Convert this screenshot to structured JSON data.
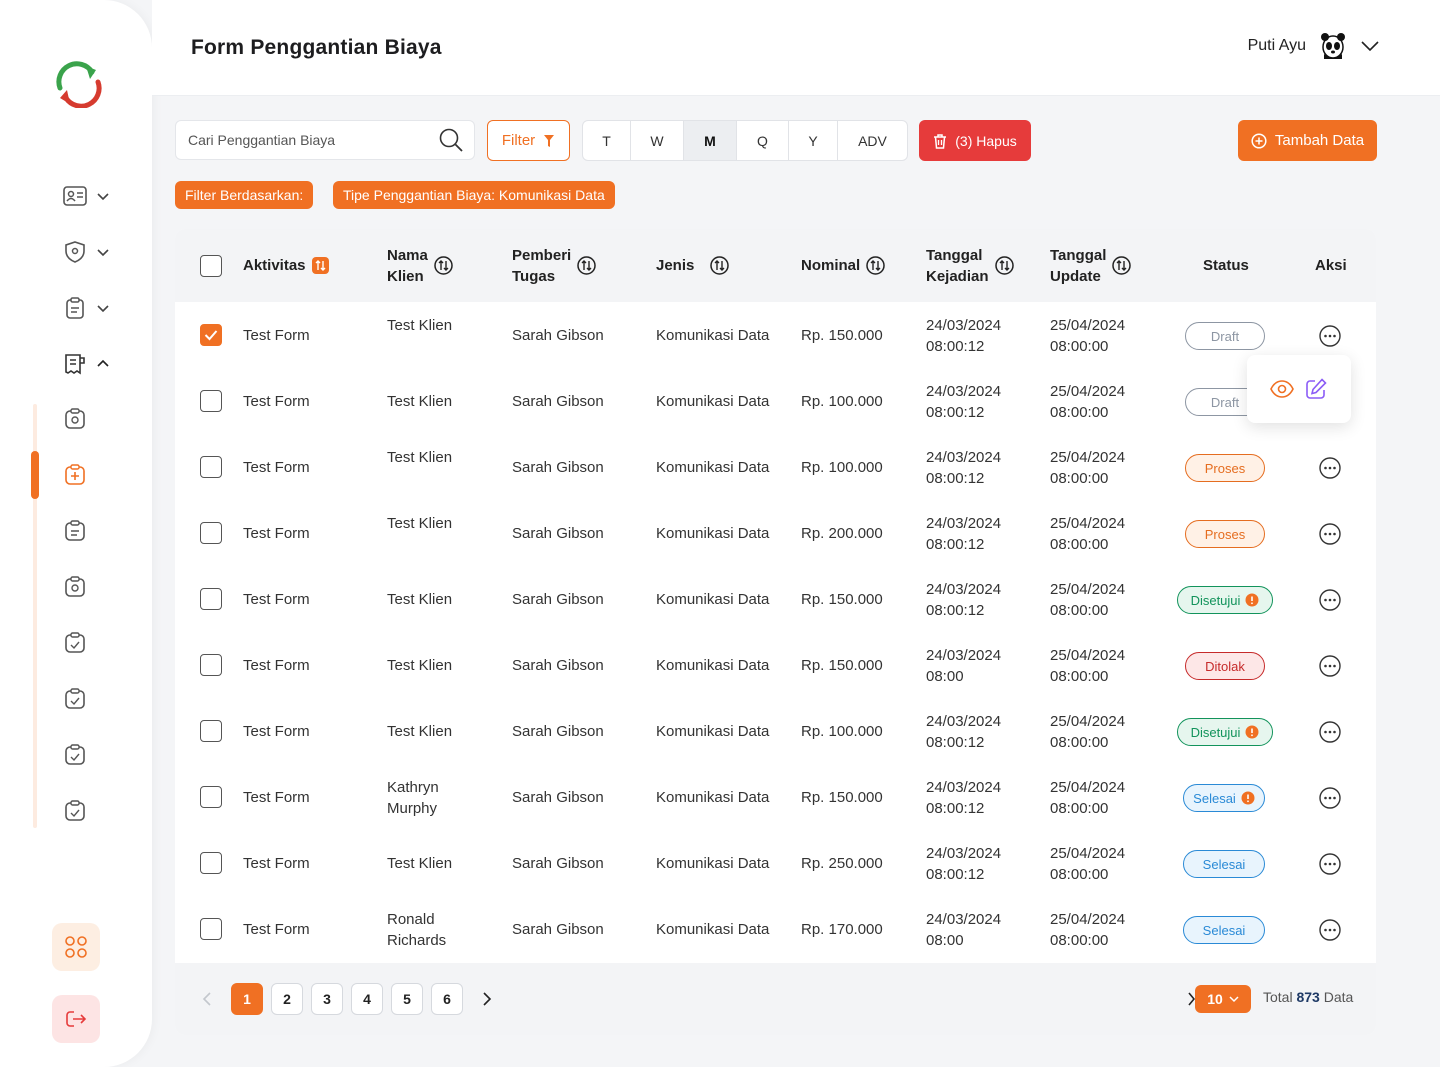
{
  "page": {
    "title": "Form Penggantian Biaya"
  },
  "user": {
    "name": "Puti Ayu"
  },
  "search": {
    "placeholder": "Cari Penggantian Biaya"
  },
  "toolbar": {
    "filter_label": "Filter",
    "periods": [
      "T",
      "W",
      "M",
      "Q",
      "Y",
      "ADV"
    ],
    "active_period": "M",
    "delete_label": "(3) Hapus",
    "add_label": "Tambah Data"
  },
  "filter_chips": {
    "label": "Filter Berdasarkan:",
    "value": "Tipe Penggantian Biaya: Komunikasi Data"
  },
  "table": {
    "headers": {
      "aktivitas": "Aktivitas",
      "klien_1": "Nama",
      "klien_2": "Klien",
      "pemberi_1": "Pemberi",
      "pemberi_2": "Tugas",
      "jenis": "Jenis",
      "nominal": "Nominal",
      "kejadian_1": "Tanggal",
      "kejadian_2": "Kejadian",
      "update_1": "Tanggal",
      "update_2": "Update",
      "status": "Status",
      "aksi": "Aksi"
    },
    "rows": [
      {
        "checked": true,
        "aktivitas": "Test Form",
        "klien": [
          "Test Klien"
        ],
        "pemberi": "Sarah Gibson",
        "jenis": "Komunikasi Data",
        "nominal": "Rp. 150.000",
        "kejadian": [
          "24/03/2024",
          "08:00:12"
        ],
        "update": [
          "25/04/2024",
          "08:00:00"
        ],
        "status": "Draft"
      },
      {
        "checked": false,
        "aktivitas": "Test Form",
        "klien": [
          "Test Klien"
        ],
        "pemberi": "Sarah Gibson",
        "jenis": "Komunikasi Data",
        "nominal": "Rp. 100.000",
        "kejadian": [
          "24/03/2024",
          "08:00:12"
        ],
        "update": [
          "25/04/2024",
          "08:00:00"
        ],
        "status": "Draft"
      },
      {
        "checked": false,
        "aktivitas": "Test Form",
        "klien": [
          "Test Klien"
        ],
        "pemberi": "Sarah Gibson",
        "jenis": "Komunikasi Data",
        "nominal": "Rp. 100.000",
        "kejadian": [
          "24/03/2024",
          "08:00:12"
        ],
        "update": [
          "25/04/2024",
          "08:00:00"
        ],
        "status": "Proses"
      },
      {
        "checked": false,
        "aktivitas": "Test Form",
        "klien": [
          "Test Klien"
        ],
        "pemberi": "Sarah Gibson",
        "jenis": "Komunikasi Data",
        "nominal": "Rp. 200.000",
        "kejadian": [
          "24/03/2024",
          "08:00:12"
        ],
        "update": [
          "25/04/2024",
          "08:00:00"
        ],
        "status": "Proses"
      },
      {
        "checked": false,
        "aktivitas": "Test Form",
        "klien": [
          "Test Klien"
        ],
        "pemberi": "Sarah Gibson",
        "jenis": "Komunikasi Data",
        "nominal": "Rp. 150.000",
        "kejadian": [
          "24/03/2024",
          "08:00:12"
        ],
        "update": [
          "25/04/2024",
          "08:00:00"
        ],
        "status": "Disetujui"
      },
      {
        "checked": false,
        "aktivitas": "Test Form",
        "klien": [
          "Test Klien"
        ],
        "pemberi": "Sarah Gibson",
        "jenis": "Komunikasi Data",
        "nominal": "Rp. 150.000",
        "kejadian": [
          "24/03/2024",
          "08:00"
        ],
        "update": [
          "25/04/2024",
          "08:00:00"
        ],
        "status": "Ditolak"
      },
      {
        "checked": false,
        "aktivitas": "Test Form",
        "klien": [
          "Test Klien"
        ],
        "pemberi": "Sarah Gibson",
        "jenis": "Komunikasi Data",
        "nominal": "Rp. 100.000",
        "kejadian": [
          "24/03/2024",
          "08:00:12"
        ],
        "update": [
          "25/04/2024",
          "08:00:00"
        ],
        "status": "Disetujui"
      },
      {
        "checked": false,
        "aktivitas": "Test Form",
        "klien": [
          "Kathryn",
          "Murphy"
        ],
        "pemberi": "Sarah Gibson",
        "jenis": "Komunikasi Data",
        "nominal": "Rp. 150.000",
        "kejadian": [
          "24/03/2024",
          "08:00:12"
        ],
        "update": [
          "25/04/2024",
          "08:00:00"
        ],
        "status": "Selesai"
      },
      {
        "checked": false,
        "aktivitas": "Test Form",
        "klien": [
          "Test Klien"
        ],
        "pemberi": "Sarah Gibson",
        "jenis": "Komunikasi Data",
        "nominal": "Rp. 250.000",
        "kejadian": [
          "24/03/2024",
          "08:00:12"
        ],
        "update": [
          "25/04/2024",
          "08:00:00"
        ],
        "status": "Selesai"
      },
      {
        "checked": false,
        "aktivitas": "Test Form",
        "klien": [
          "Ronald",
          "Richards"
        ],
        "pemberi": "Sarah Gibson",
        "jenis": "Komunikasi Data",
        "nominal": "Rp. 170.000",
        "kejadian": [
          "24/03/2024",
          "08:00"
        ],
        "update": [
          "25/04/2024",
          "08:00:00"
        ],
        "status": "Selesai"
      }
    ]
  },
  "pagination": {
    "pages": [
      "1",
      "2",
      "3",
      "4",
      "5",
      "6"
    ],
    "current": "1",
    "per_page": "10",
    "total_prefix": "Total",
    "total_count": "873",
    "total_suffix": "Data"
  },
  "colors": {
    "accent": "#f07023",
    "danger": "#e63b3b"
  }
}
